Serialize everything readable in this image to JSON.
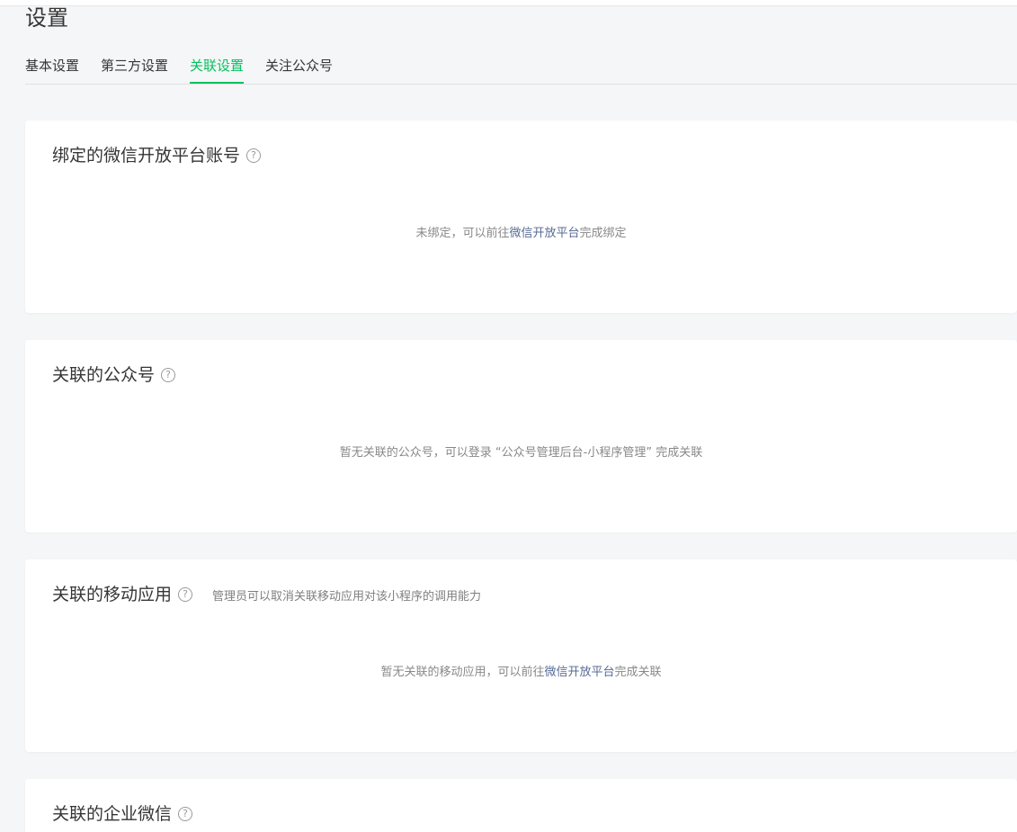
{
  "page": {
    "title": "设置"
  },
  "tabs": [
    {
      "label": "基本设置"
    },
    {
      "label": "第三方设置"
    },
    {
      "label": "关联设置",
      "active": true
    },
    {
      "label": "关注公众号"
    }
  ],
  "colors": {
    "accent": "#07c160",
    "link": "#576b95"
  },
  "sections": {
    "open_platform": {
      "title": "绑定的微信开放平台账号",
      "empty_prefix": "未绑定，可以前往",
      "empty_link": "微信开放平台",
      "empty_suffix": "完成绑定"
    },
    "official_account": {
      "title": "关联的公众号",
      "empty_text": "暂无关联的公众号，可以登录 “公众号管理后台-小程序管理” 完成关联"
    },
    "mobile_app": {
      "title": "关联的移动应用",
      "description": "管理员可以取消关联移动应用对该小程序的调用能力",
      "empty_prefix": "暂无关联的移动应用，可以前往",
      "empty_link": "微信开放平台",
      "empty_suffix": "完成关联"
    },
    "wecom": {
      "title": "关联的企业微信"
    }
  },
  "icons": {
    "help": "question-circle-icon",
    "help_glyph": "?"
  }
}
